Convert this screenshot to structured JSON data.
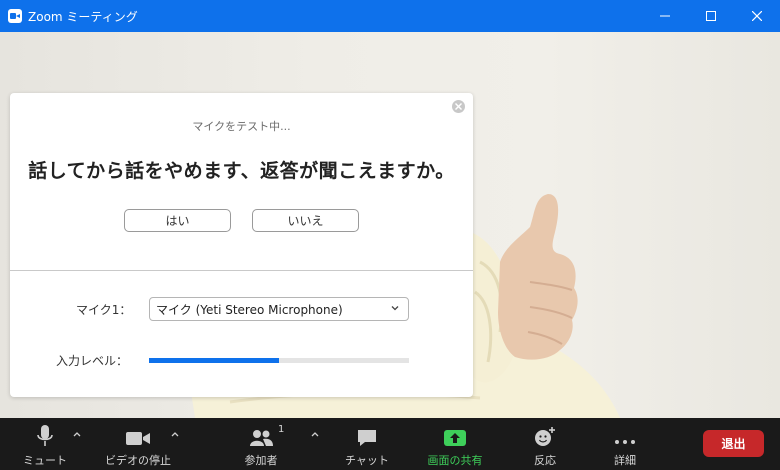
{
  "window": {
    "title": "Zoom ミーティング",
    "icon": "zoom-camera-icon"
  },
  "dialog": {
    "status": "マイクをテスト中...",
    "question": "話してから話をやめます、返答が聞こえますか。",
    "yes_label": "はい",
    "no_label": "いいえ",
    "mic_label": "マイク1：",
    "mic_value": "マイク (Yeti Stereo Microphone)",
    "level_label": "入力レベル：",
    "input_level_fraction": 0.5
  },
  "toolbar": {
    "mute_label": "ミュート",
    "video_label": "ビデオの停止",
    "participants_label": "参加者",
    "participants_count": "1",
    "chat_label": "チャット",
    "share_label": "画面の共有",
    "reactions_label": "反応",
    "more_label": "詳細",
    "end_label": "退出"
  },
  "colors": {
    "accent": "#0e71eb",
    "share_green": "#3ecf5a",
    "end_red": "#c6282a",
    "toolbar_bg": "#1a1a1a"
  }
}
